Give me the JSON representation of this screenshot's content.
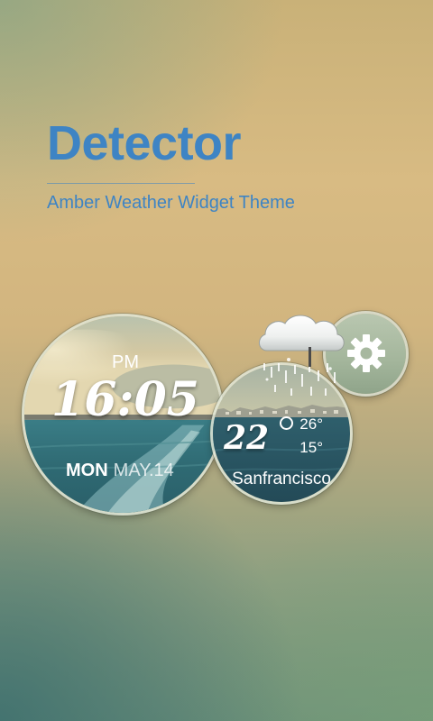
{
  "header": {
    "title": "Detector",
    "subtitle": "Amber Weather Widget Theme"
  },
  "clock": {
    "ampm": "PM",
    "time": "16:05",
    "day_of_week": "MON",
    "month_day": "MAY.14"
  },
  "weather": {
    "current_temp": "22",
    "high": "26°",
    "low": "15°",
    "city": "Sanfrancisco",
    "condition_icon": "cloud-rain-icon"
  },
  "settings": {
    "icon": "gear-icon"
  },
  "colors": {
    "accent": "#3e84c4",
    "background_top": "#c9b178",
    "background_bottom": "#6f917a"
  }
}
